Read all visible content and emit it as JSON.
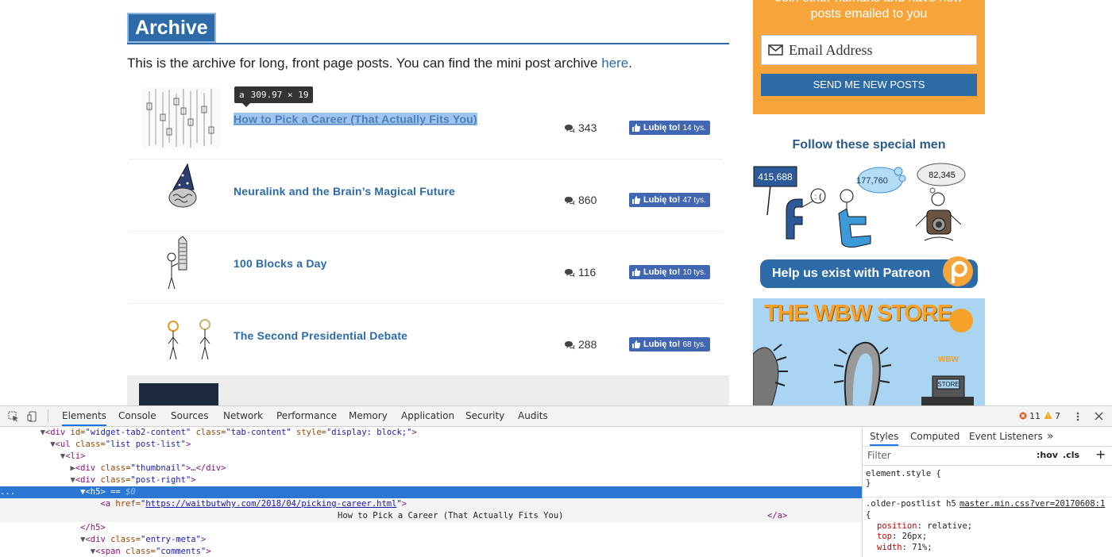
{
  "archive": {
    "title": "Archive",
    "intro_text": "This is the archive for long, front page posts. You can find the mini post archive ",
    "intro_link": "here",
    "intro_end": "."
  },
  "tooltip": {
    "tag": "a",
    "size": "309.97 × 19"
  },
  "posts": [
    {
      "title": "How to Pick a Career (That Actually Fits You)",
      "comments": "343",
      "like_label": "Lubię to!",
      "like_count": "14 tys."
    },
    {
      "title": "Neuralink and the Brain’s Magical Future",
      "comments": "860",
      "like_label": "Lubię to!",
      "like_count": "47 tys."
    },
    {
      "title": "100 Blocks a Day",
      "comments": "116",
      "like_label": "Lubię to!",
      "like_count": "10 tys."
    },
    {
      "title": "The Second Presidential Debate",
      "comments": "288",
      "like_label": "Lubię to!",
      "like_count": "68 tys."
    }
  ],
  "sidebar": {
    "subscribe_text_1": "Join other humans and have new",
    "subscribe_text_2": "posts emailed to you",
    "email_placeholder": "Email Address",
    "send_button": "SEND ME NEW POSTS",
    "follow_title": "Follow these special men",
    "facebook_count": "415,688",
    "twitter_count": "177,760",
    "instagram_count": "82,345",
    "patreon_label": "Help us exist with Patreon",
    "store_title_1": "THE",
    "store_title_2": "WBW",
    "store_title_3": "STORE",
    "store_sign": "WBW",
    "store_sign2": "STORE"
  },
  "devtools": {
    "tabs": [
      "Elements",
      "Console",
      "Sources",
      "Network",
      "Performance",
      "Memory",
      "Application",
      "Security",
      "Audits"
    ],
    "errors": "11",
    "warnings": "7",
    "dom": {
      "l1_tag": "<div",
      "l1_attr1": " id=",
      "l1_val1": "\"widget-tab2-content\"",
      "l1_attr2": " class=",
      "l1_val2": "\"tab-content\"",
      "l1_attr3": " style=",
      "l1_val3": "\"display: block;\"",
      "l1_end": ">",
      "l2_tag": "<ul",
      "l2_attr": " class=",
      "l2_val": "\"list post-list\"",
      "l2_end": ">",
      "l3": "<li>",
      "l4_tag": "<div",
      "l4_attr": " class=",
      "l4_val": "\"thumbnail\"",
      "l4_end": ">…</div>",
      "l5_tag": "<div",
      "l5_attr": " class=",
      "l5_val": "\"post-right\"",
      "l5_end": ">",
      "l6_tag": "<h5>",
      "l6_eq": " == ",
      "l6_dollar": "$0",
      "l7_tag": "<a",
      "l7_attr": " href=",
      "l7_q1": "\"",
      "l7_href": "https://waitbutwhy.com/2018/04/picking-career.html",
      "l7_q2": "\"",
      "l7_end": ">",
      "l8_text": "How to Pick a Career (That Actually Fits You)",
      "l8_close": "</a>",
      "l9": "</h5>",
      "l10_tag": "<div",
      "l10_attr": " class=",
      "l10_val": "\"entry-meta\"",
      "l10_end": ">",
      "l11_tag": "<span",
      "l11_attr": " class=",
      "l11_val": "\"comments\"",
      "l11_end": ">"
    },
    "styles_tabs": [
      "Styles",
      "Computed",
      "Event Listeners"
    ],
    "filter_placeholder": "Filter",
    "hov": ":hov",
    "cls": ".cls",
    "element_style": "element.style {",
    "close_brace": "}",
    "rule_selector": ".older-postlist h5",
    "rule_source": "master.min.css?ver=20170608:1",
    "open_brace": "{",
    "props": [
      {
        "name": "position",
        "value": "relative;"
      },
      {
        "name": "top",
        "value": "26px;"
      },
      {
        "name": "width",
        "value": "71%;"
      }
    ]
  }
}
